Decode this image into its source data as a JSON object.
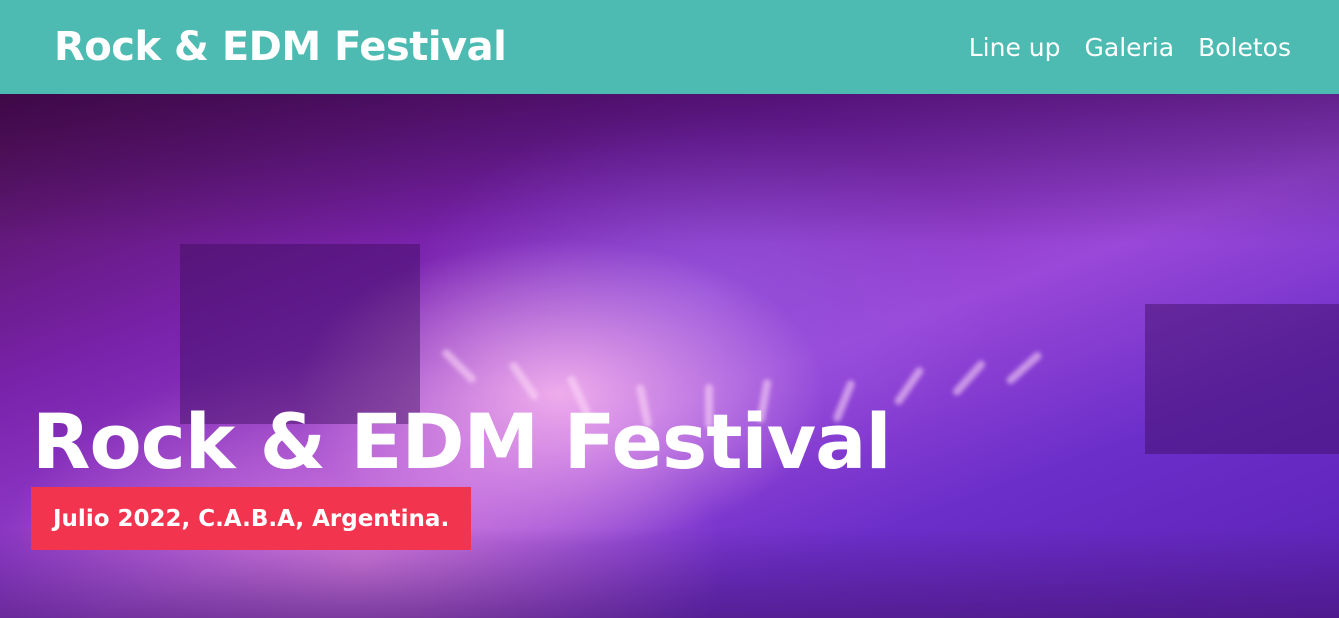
{
  "header": {
    "brand": "Rock & EDM Festival",
    "nav": [
      "Line up",
      "Galeria",
      "Boletos"
    ]
  },
  "hero": {
    "title": "Rock & EDM Festival",
    "subtitle": "Julio 2022, C.A.B.A, Argentina."
  },
  "colors": {
    "header_bg": "#4dbbb2",
    "badge_bg": "#f3344f",
    "text": "#ffffff"
  }
}
